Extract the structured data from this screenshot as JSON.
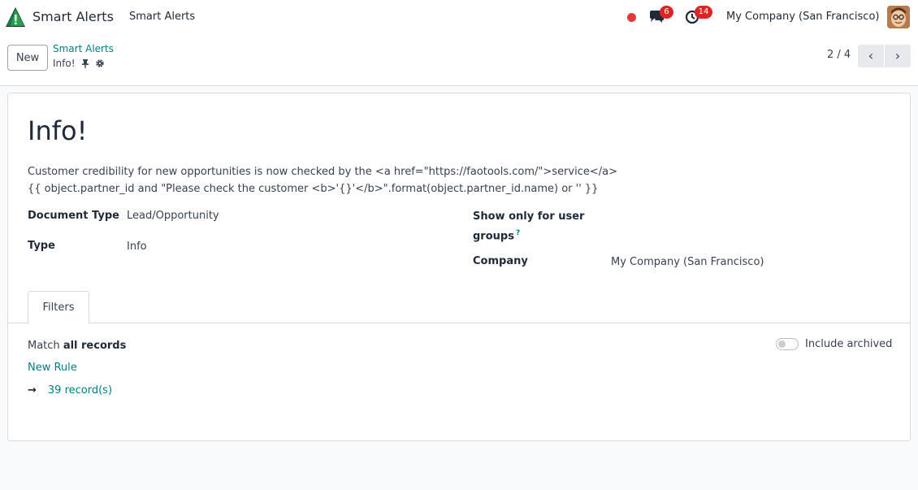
{
  "navbar": {
    "app_name": "Smart Alerts",
    "menu_item": "Smart Alerts",
    "messages_count": "6",
    "activities_count": "14",
    "company": "My Company (San Francisco)"
  },
  "control_panel": {
    "new_label": "New",
    "breadcrumb_parent": "Smart Alerts",
    "breadcrumb_current": "Info!",
    "pager_value": "2 / 4",
    "prev_icon": "chevron-left-icon",
    "next_icon": "chevron-right-icon"
  },
  "form": {
    "title": "Info!",
    "description_line1": "Customer credibility for new opportunities is now checked by the <a href=\"https://faotools.com/\">service</a>",
    "description_line2": "{{ object.partner_id and \"Please check the customer <b>'{}'</b>\".format(object.partner_id.name) or '' }}",
    "fields": {
      "document_type_label": "Document Type",
      "document_type_value": "Lead/Opportunity",
      "type_label": "Type",
      "type_value": "Info",
      "user_groups_label_1": "Show only for user",
      "user_groups_label_2": "groups",
      "help_mark": "?",
      "company_label": "Company",
      "company_value": "My Company (San Francisco)"
    },
    "tabs": [
      {
        "label": "Filters",
        "active": true
      }
    ],
    "filters": {
      "match_prefix": "Match",
      "match_bold": "all records",
      "include_archived": "Include archived",
      "include_archived_on": false,
      "new_rule": "New Rule",
      "records_arrow": "→",
      "records_count": "39 record(s)"
    }
  },
  "colors": {
    "accent": "#017e84",
    "badge": "#dc2626",
    "status_dot": "#e03a3a"
  }
}
